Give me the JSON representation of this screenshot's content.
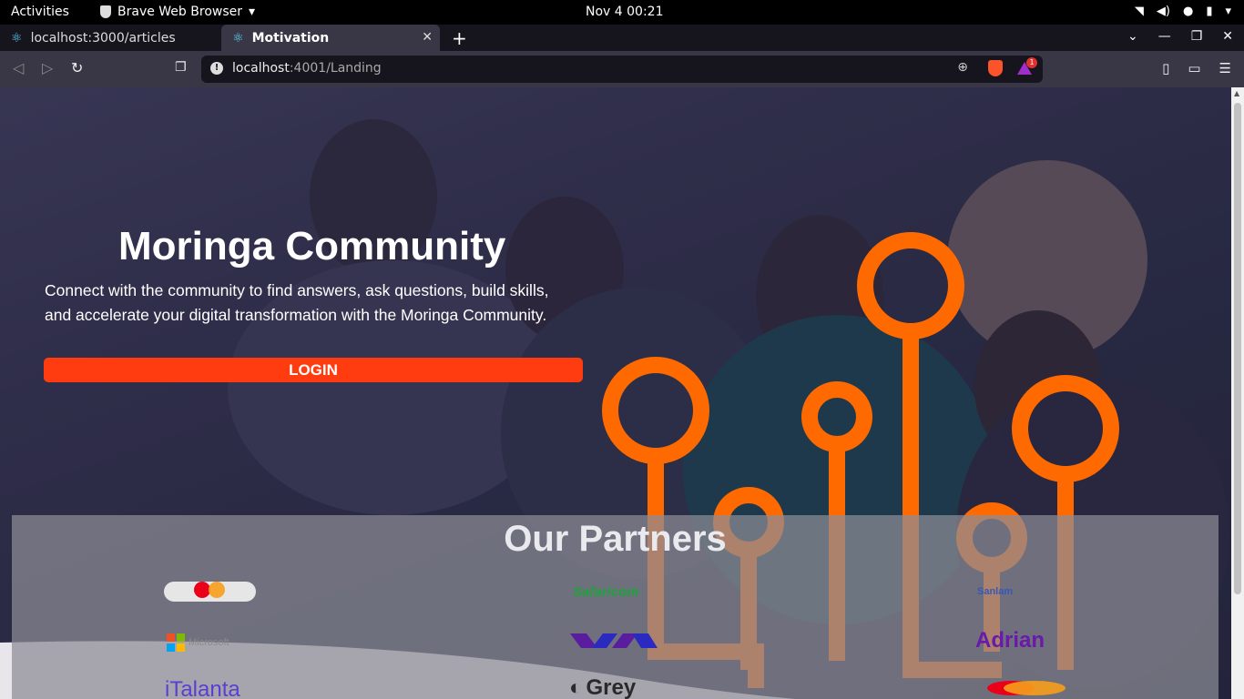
{
  "system_bar": {
    "activities": "Activities",
    "app_name": "Brave Web Browser",
    "clock": "Nov 4  00:21"
  },
  "tabs": [
    {
      "title": "localhost:3000/articles",
      "active": false
    },
    {
      "title": "Motivation",
      "active": true
    }
  ],
  "address_bar": {
    "host": "localhost",
    "rest": ":4001/Landing"
  },
  "rewards_badge": "1",
  "hero": {
    "title": "Moringa Community",
    "line1": "Connect with the community to find answers, ask questions, build skills,",
    "line2": "and accelerate your digital transformation with the Moringa Community.",
    "login_label": "LOGIN"
  },
  "partners": {
    "title": "Our Partners",
    "logos": {
      "safaricom": "Safaricom",
      "sanlam": "Sanlam",
      "microsoft": "Microsoft",
      "adrian": "Adrian",
      "italanta": "iTalanta",
      "grey": "Grey",
      "mastercard": "mastercard"
    }
  },
  "colors": {
    "accent": "#ff3c0f",
    "orange_art": "#ff6a00",
    "partners_bg": "#8c8c96"
  }
}
